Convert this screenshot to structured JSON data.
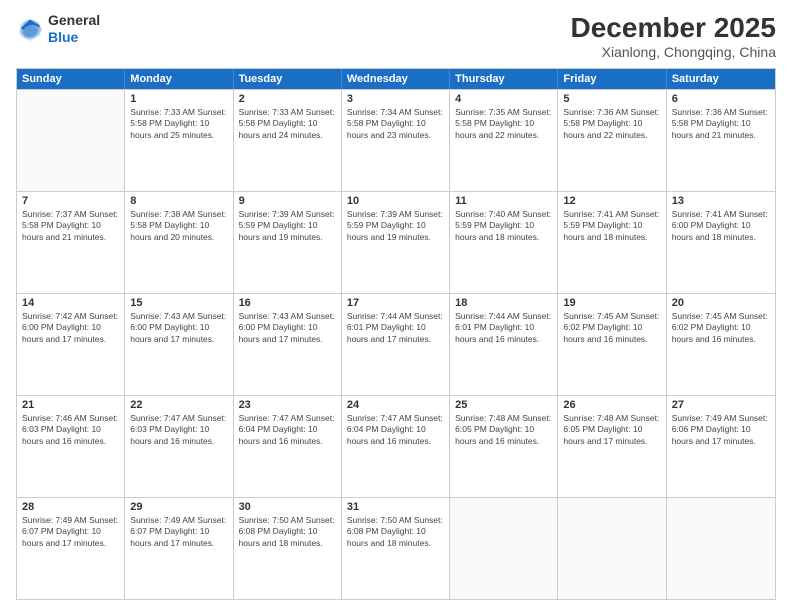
{
  "logo": {
    "line1": "General",
    "line2": "Blue"
  },
  "title": "December 2025",
  "subtitle": "Xianlong, Chongqing, China",
  "header_days": [
    "Sunday",
    "Monday",
    "Tuesday",
    "Wednesday",
    "Thursday",
    "Friday",
    "Saturday"
  ],
  "weeks": [
    [
      {
        "day": "",
        "info": ""
      },
      {
        "day": "1",
        "info": "Sunrise: 7:33 AM\nSunset: 5:58 PM\nDaylight: 10 hours\nand 25 minutes."
      },
      {
        "day": "2",
        "info": "Sunrise: 7:33 AM\nSunset: 5:58 PM\nDaylight: 10 hours\nand 24 minutes."
      },
      {
        "day": "3",
        "info": "Sunrise: 7:34 AM\nSunset: 5:58 PM\nDaylight: 10 hours\nand 23 minutes."
      },
      {
        "day": "4",
        "info": "Sunrise: 7:35 AM\nSunset: 5:58 PM\nDaylight: 10 hours\nand 22 minutes."
      },
      {
        "day": "5",
        "info": "Sunrise: 7:36 AM\nSunset: 5:58 PM\nDaylight: 10 hours\nand 22 minutes."
      },
      {
        "day": "6",
        "info": "Sunrise: 7:36 AM\nSunset: 5:58 PM\nDaylight: 10 hours\nand 21 minutes."
      }
    ],
    [
      {
        "day": "7",
        "info": "Sunrise: 7:37 AM\nSunset: 5:58 PM\nDaylight: 10 hours\nand 21 minutes."
      },
      {
        "day": "8",
        "info": "Sunrise: 7:38 AM\nSunset: 5:58 PM\nDaylight: 10 hours\nand 20 minutes."
      },
      {
        "day": "9",
        "info": "Sunrise: 7:39 AM\nSunset: 5:59 PM\nDaylight: 10 hours\nand 19 minutes."
      },
      {
        "day": "10",
        "info": "Sunrise: 7:39 AM\nSunset: 5:59 PM\nDaylight: 10 hours\nand 19 minutes."
      },
      {
        "day": "11",
        "info": "Sunrise: 7:40 AM\nSunset: 5:59 PM\nDaylight: 10 hours\nand 18 minutes."
      },
      {
        "day": "12",
        "info": "Sunrise: 7:41 AM\nSunset: 5:59 PM\nDaylight: 10 hours\nand 18 minutes."
      },
      {
        "day": "13",
        "info": "Sunrise: 7:41 AM\nSunset: 6:00 PM\nDaylight: 10 hours\nand 18 minutes."
      }
    ],
    [
      {
        "day": "14",
        "info": "Sunrise: 7:42 AM\nSunset: 6:00 PM\nDaylight: 10 hours\nand 17 minutes."
      },
      {
        "day": "15",
        "info": "Sunrise: 7:43 AM\nSunset: 6:00 PM\nDaylight: 10 hours\nand 17 minutes."
      },
      {
        "day": "16",
        "info": "Sunrise: 7:43 AM\nSunset: 6:00 PM\nDaylight: 10 hours\nand 17 minutes."
      },
      {
        "day": "17",
        "info": "Sunrise: 7:44 AM\nSunset: 6:01 PM\nDaylight: 10 hours\nand 17 minutes."
      },
      {
        "day": "18",
        "info": "Sunrise: 7:44 AM\nSunset: 6:01 PM\nDaylight: 10 hours\nand 16 minutes."
      },
      {
        "day": "19",
        "info": "Sunrise: 7:45 AM\nSunset: 6:02 PM\nDaylight: 10 hours\nand 16 minutes."
      },
      {
        "day": "20",
        "info": "Sunrise: 7:45 AM\nSunset: 6:02 PM\nDaylight: 10 hours\nand 16 minutes."
      }
    ],
    [
      {
        "day": "21",
        "info": "Sunrise: 7:46 AM\nSunset: 6:03 PM\nDaylight: 10 hours\nand 16 minutes."
      },
      {
        "day": "22",
        "info": "Sunrise: 7:47 AM\nSunset: 6:03 PM\nDaylight: 10 hours\nand 16 minutes."
      },
      {
        "day": "23",
        "info": "Sunrise: 7:47 AM\nSunset: 6:04 PM\nDaylight: 10 hours\nand 16 minutes."
      },
      {
        "day": "24",
        "info": "Sunrise: 7:47 AM\nSunset: 6:04 PM\nDaylight: 10 hours\nand 16 minutes."
      },
      {
        "day": "25",
        "info": "Sunrise: 7:48 AM\nSunset: 6:05 PM\nDaylight: 10 hours\nand 16 minutes."
      },
      {
        "day": "26",
        "info": "Sunrise: 7:48 AM\nSunset: 6:05 PM\nDaylight: 10 hours\nand 17 minutes."
      },
      {
        "day": "27",
        "info": "Sunrise: 7:49 AM\nSunset: 6:06 PM\nDaylight: 10 hours\nand 17 minutes."
      }
    ],
    [
      {
        "day": "28",
        "info": "Sunrise: 7:49 AM\nSunset: 6:07 PM\nDaylight: 10 hours\nand 17 minutes."
      },
      {
        "day": "29",
        "info": "Sunrise: 7:49 AM\nSunset: 6:07 PM\nDaylight: 10 hours\nand 17 minutes."
      },
      {
        "day": "30",
        "info": "Sunrise: 7:50 AM\nSunset: 6:08 PM\nDaylight: 10 hours\nand 18 minutes."
      },
      {
        "day": "31",
        "info": "Sunrise: 7:50 AM\nSunset: 6:08 PM\nDaylight: 10 hours\nand 18 minutes."
      },
      {
        "day": "",
        "info": ""
      },
      {
        "day": "",
        "info": ""
      },
      {
        "day": "",
        "info": ""
      }
    ]
  ]
}
